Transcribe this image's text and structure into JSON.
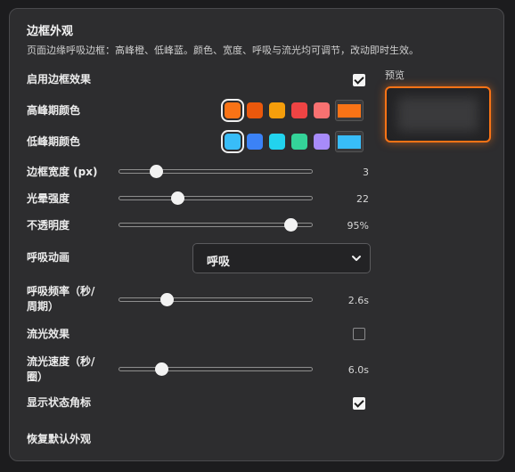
{
  "header": {
    "title": "边框外观",
    "description": "页面边缘呼吸边框：高峰橙、低峰蓝。颜色、宽度、呼吸与流光均可调节，改动即时生效。"
  },
  "settings": {
    "enable_border": {
      "label": "启用边框效果",
      "checked": true
    },
    "peak_color": {
      "label": "高峰期颜色",
      "swatches": [
        "#f97316",
        "#ea580c",
        "#f59e0b",
        "#ef4444",
        "#f87171"
      ],
      "selected": "#f97316",
      "custom": "#f97316"
    },
    "low_color": {
      "label": "低峰期颜色",
      "swatches": [
        "#38bdf8",
        "#3b82f6",
        "#22d3ee",
        "#34d399",
        "#a78bfa"
      ],
      "selected": "#38bdf8",
      "custom": "#38bdf8"
    },
    "border_width": {
      "label": "边框宽度 (px)",
      "value": "3",
      "fraction": 0.17
    },
    "glow_strength": {
      "label": "光晕强度",
      "value": "22",
      "fraction": 0.29
    },
    "opacity": {
      "label": "不透明度",
      "value": "95%",
      "fraction": 0.91
    },
    "breath_animation": {
      "label": "呼吸动画",
      "selected": "呼吸"
    },
    "breath_frequency": {
      "label_line1": "呼吸频率（秒/",
      "label_line2": "周期）",
      "value": "2.6s",
      "fraction": 0.23
    },
    "flow_effect": {
      "label": "流光效果",
      "checked": false
    },
    "flow_speed": {
      "label_line1": "流光速度（秒/",
      "label_line2": "圈）",
      "value": "6.0s",
      "fraction": 0.2
    },
    "show_badge": {
      "label": "显示状态角标",
      "checked": true
    }
  },
  "preview": {
    "label": "预览",
    "border_color": "#f97316"
  },
  "footer": {
    "reset_label": "恢复默认外观"
  }
}
